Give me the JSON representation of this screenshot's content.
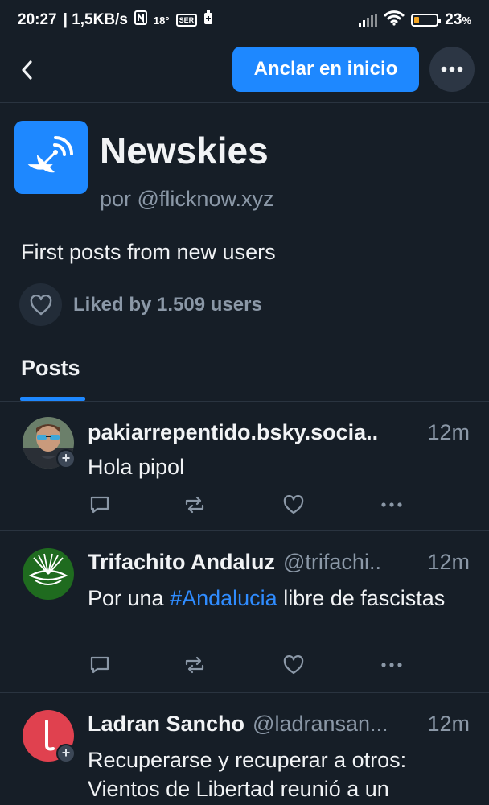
{
  "status_bar": {
    "time": "20:27",
    "speed": "| 1,5KB/s",
    "temp": "18°",
    "radio": "SER",
    "battery_percent": "23",
    "percent_sign": "%",
    "battery_level": 0.23
  },
  "header": {
    "back_icon": "chevron-left-icon",
    "pin_label": "Anclar en inicio",
    "more_icon": "ellipsis-icon"
  },
  "feed": {
    "title": "Newskies",
    "author": "por @flicknow.xyz",
    "description": "First posts from new users",
    "likes_text": "Liked by 1.509 users",
    "icon": "satellite-dish-icon",
    "accent": "#1e88ff"
  },
  "tabs": [
    {
      "label": "Posts",
      "active": true
    }
  ],
  "posts": [
    {
      "name": "pakiarrepentido.bsky.socia..",
      "handle": "",
      "time": "12m",
      "text": "Hola pipol",
      "hashtag": "",
      "text_after": ""
    },
    {
      "name": "Trifachito Andaluz",
      "handle": "@trifachi..",
      "time": "12m",
      "text": "Por una ",
      "hashtag": "#Andalucia",
      "text_after": " libre de fascistas"
    },
    {
      "name": "Ladran Sancho",
      "handle": "@ladransan...",
      "time": "12m",
      "text": "Recuperarse y recuperar a otros: Vientos de Libertad reunió a un",
      "hashtag": "",
      "text_after": ""
    }
  ],
  "post_actions": [
    "reply-icon",
    "repost-icon",
    "like-icon",
    "more-icon"
  ]
}
